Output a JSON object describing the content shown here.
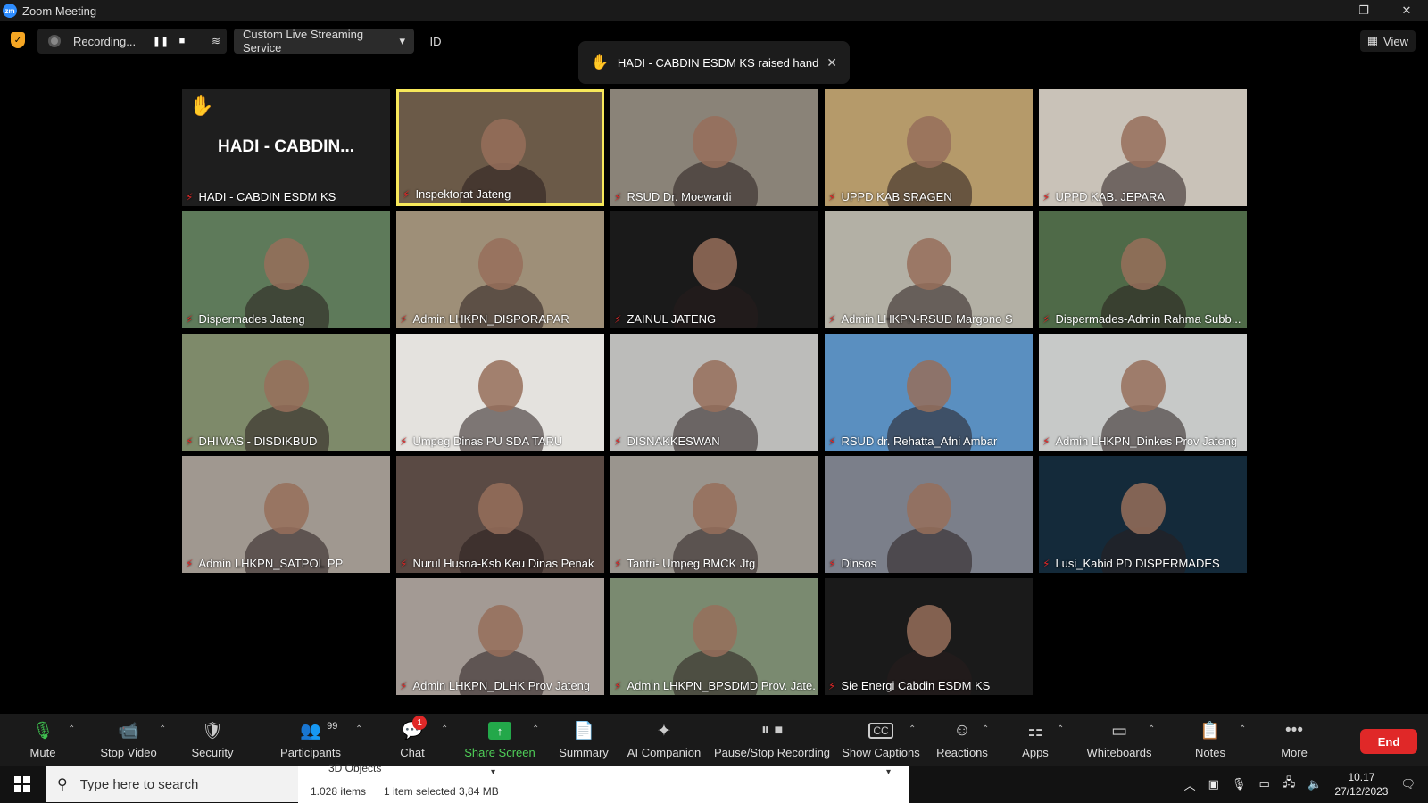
{
  "window": {
    "title": "Zoom Meeting",
    "logo_text": "zm",
    "minimize": "—",
    "restore": "❐",
    "close": "✕"
  },
  "topbar": {
    "recording_label": "Recording...",
    "pause_icon": "❚❚",
    "stop_icon": "■",
    "rss_icon": "≋",
    "stream_service": "Custom Live Streaming Service",
    "stream_caret": "▾",
    "id_label": "ID",
    "view_label": "View",
    "view_icon": "▦"
  },
  "notification": {
    "text": "HADI - CABDIN ESDM KS raised hand",
    "hand_icon": "✋",
    "close_icon": "✕"
  },
  "mic_muted_icon": "⚡",
  "raised_hand_tile": {
    "big_name": "HADI - CABDIN...",
    "hand_icon": "✋"
  },
  "participants": [
    {
      "name": "HADI - CABDIN ESDM KS",
      "bg": "#1e1e1e"
    },
    {
      "name": "Inspektorat Jateng",
      "bg": "#6b5a48",
      "active": true
    },
    {
      "name": "RSUD Dr. Moewardi",
      "bg": "#8a8378"
    },
    {
      "name": "UPPD KAB SRAGEN",
      "bg": "#b59a6a"
    },
    {
      "name": "UPPD KAB. JEPARA",
      "bg": "#c9c2b8"
    },
    {
      "name": "Dispermades Jateng",
      "bg": "#5e7a5a"
    },
    {
      "name": "Admin LHKPN_DISPORAPAR",
      "bg": "#9e8f78"
    },
    {
      "name": "ZAINUL JATENG",
      "bg": "#1a1a1a"
    },
    {
      "name": "Admin LHKPN-RSUD Margono S",
      "bg": "#b3b0a5"
    },
    {
      "name": "Dispermades-Admin Rahma Subb...",
      "bg": "#4f6a48"
    },
    {
      "name": "DHIMAS - DISDIKBUD",
      "bg": "#7e8a6a"
    },
    {
      "name": "Umpeg Dinas PU SDA TARU",
      "bg": "#e4e2de"
    },
    {
      "name": "DISNAKKESWAN",
      "bg": "#bcbcba"
    },
    {
      "name": "RSUD dr. Rehatta_Afni Ambar",
      "bg": "#5a8fc0"
    },
    {
      "name": "Admin LHKPN_Dinkes Prov Jateng",
      "bg": "#c7c9c8"
    },
    {
      "name": "Admin LHKPN_SATPOL PP",
      "bg": "#a09890"
    },
    {
      "name": "Nurul Husna-Ksb Keu Dinas Penak",
      "bg": "#5a4a44"
    },
    {
      "name": "Tantri- Umpeg BMCK Jtg",
      "bg": "#9a958e"
    },
    {
      "name": "Dinsos",
      "bg": "#7b7f8a"
    },
    {
      "name": "Lusi_Kabid PD DISPERMADES",
      "bg": "#142a3a"
    },
    {
      "name": "Admin LHKPN_DLHK Prov Jateng",
      "bg": "#a39a94"
    },
    {
      "name": "Admin LHKPN_BPSDMD Prov. Jate...",
      "bg": "#7a8a70"
    },
    {
      "name": "Sie Energi Cabdin ESDM KS",
      "bg": "#1a1a1a"
    }
  ],
  "toolbar": {
    "mute": "Mute",
    "stop_video": "Stop Video",
    "security": "Security",
    "participants": "Participants",
    "participants_count": "99",
    "chat": "Chat",
    "chat_badge": "1",
    "share_screen": "Share Screen",
    "summary": "Summary",
    "ai_companion": "AI Companion",
    "pause_stop_recording": "Pause/Stop Recording",
    "show_captions": "Show Captions",
    "reactions": "Reactions",
    "apps": "Apps",
    "whiteboards": "Whiteboards",
    "notes": "Notes",
    "more": "More",
    "end": "End",
    "caret": "⌃"
  },
  "taskbar": {
    "search_placeholder": "Type here to search",
    "explorer_title": "3D Objects",
    "explorer_items": "1.028 items",
    "explorer_selected": "1 item selected  3,84 MB",
    "time": "10.17",
    "date": "27/12/2023"
  }
}
